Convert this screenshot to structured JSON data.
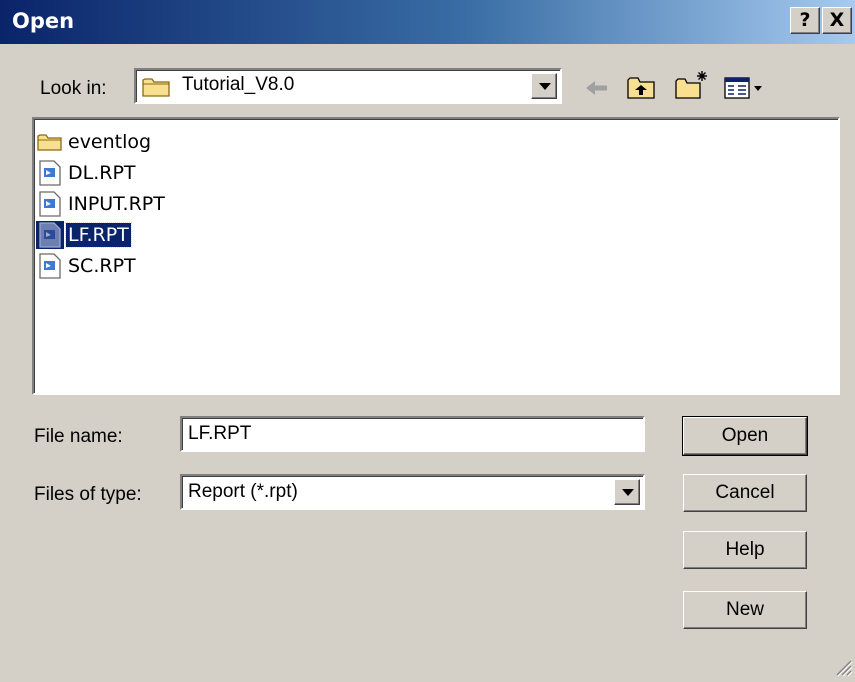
{
  "window": {
    "title": "Open",
    "help_button": "?",
    "close_button": "X"
  },
  "look_in": {
    "label": "Look in:",
    "value": "Tutorial_V8.0",
    "icon": "folder-icon"
  },
  "toolbar": {
    "back_icon": "back-arrow-icon",
    "up_icon": "up-folder-icon",
    "new_folder_icon": "new-folder-icon",
    "view_menu_icon": "view-menu-icon"
  },
  "files": [
    {
      "name": "eventlog",
      "type": "folder",
      "selected": false
    },
    {
      "name": "DL.RPT",
      "type": "file",
      "selected": false
    },
    {
      "name": "INPUT.RPT",
      "type": "file",
      "selected": false
    },
    {
      "name": "LF.RPT",
      "type": "file",
      "selected": true
    },
    {
      "name": "SC.RPT",
      "type": "file",
      "selected": false
    }
  ],
  "file_name": {
    "label": "File name:",
    "value": "LF.RPT"
  },
  "file_type": {
    "label": "Files of type:",
    "value": "Report (*.rpt)"
  },
  "buttons": {
    "open": "Open",
    "cancel": "Cancel",
    "help": "Help",
    "new": "New"
  },
  "colors": {
    "title_bar": "#0a246a",
    "dialog_bg": "#d4d0c8",
    "selection": "#0a246a"
  }
}
